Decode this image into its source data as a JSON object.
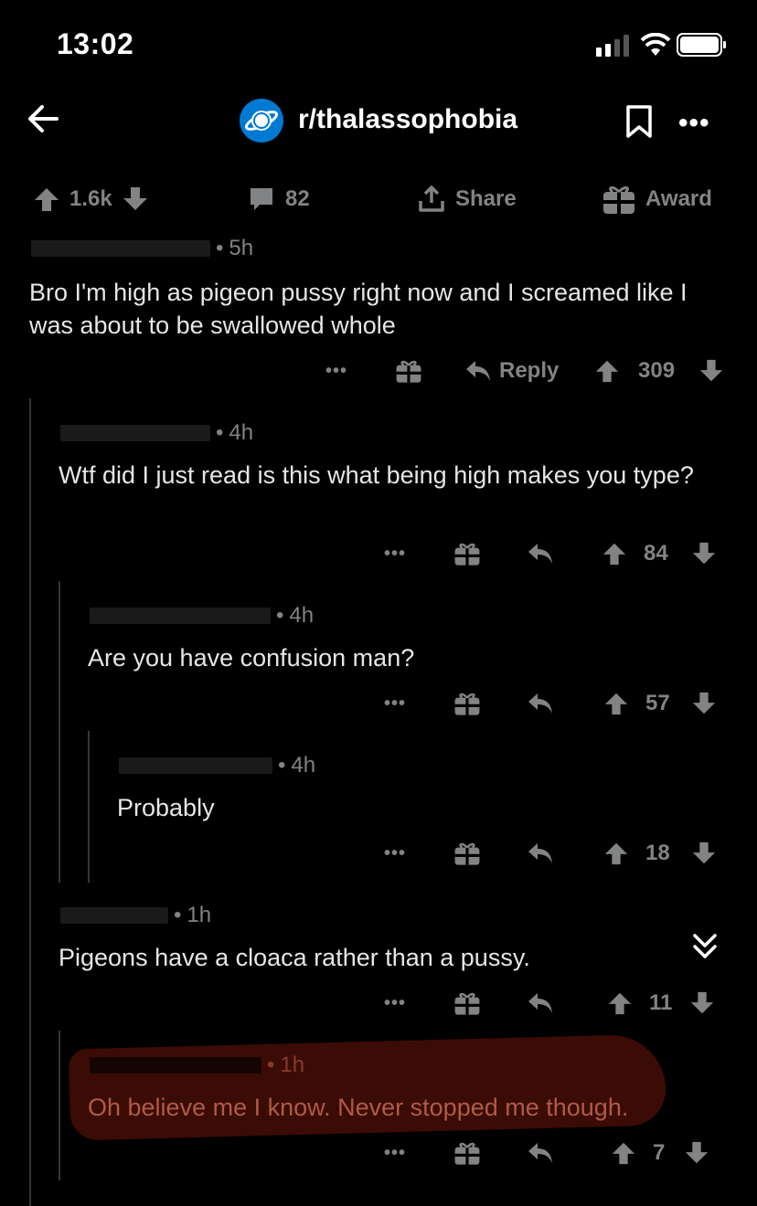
{
  "status_bar": {
    "time": "13:02"
  },
  "header": {
    "subreddit": "r/thalassophobia"
  },
  "post_bar": {
    "votes": "1.6k",
    "comments": "82",
    "share": "Share",
    "award": "Award"
  },
  "comments": [
    {
      "time": "5h",
      "text": "Bro I'm high as pigeon pussy right now and I screamed like I was about to be swallowed whole",
      "reply": "Reply",
      "score": "309"
    },
    {
      "time": "4h",
      "text": "Wtf did I just read is this what being high makes you type?",
      "score": "84"
    },
    {
      "time": "4h",
      "text": "Are you have confusion man?",
      "score": "57"
    },
    {
      "time": "4h",
      "text": "Probably",
      "score": "18"
    },
    {
      "time": "1h",
      "text": "Pigeons have a cloaca rather than a pussy.",
      "score": "11"
    },
    {
      "time": "1h",
      "text": "Oh believe me I know.  Never stopped me though.",
      "score": "7"
    }
  ],
  "colors": {
    "background": "#000000",
    "muted": "#818384",
    "text": "#e4e6e7",
    "highlight": "#3a0c05",
    "subreddit_icon": "#0079d3"
  },
  "icons": [
    "back-arrow-icon",
    "planet-icon",
    "bookmark-icon",
    "more-icon",
    "upvote-icon",
    "downvote-icon",
    "comment-icon",
    "share-icon",
    "gift-icon",
    "reply-icon",
    "collapse-icon"
  ]
}
